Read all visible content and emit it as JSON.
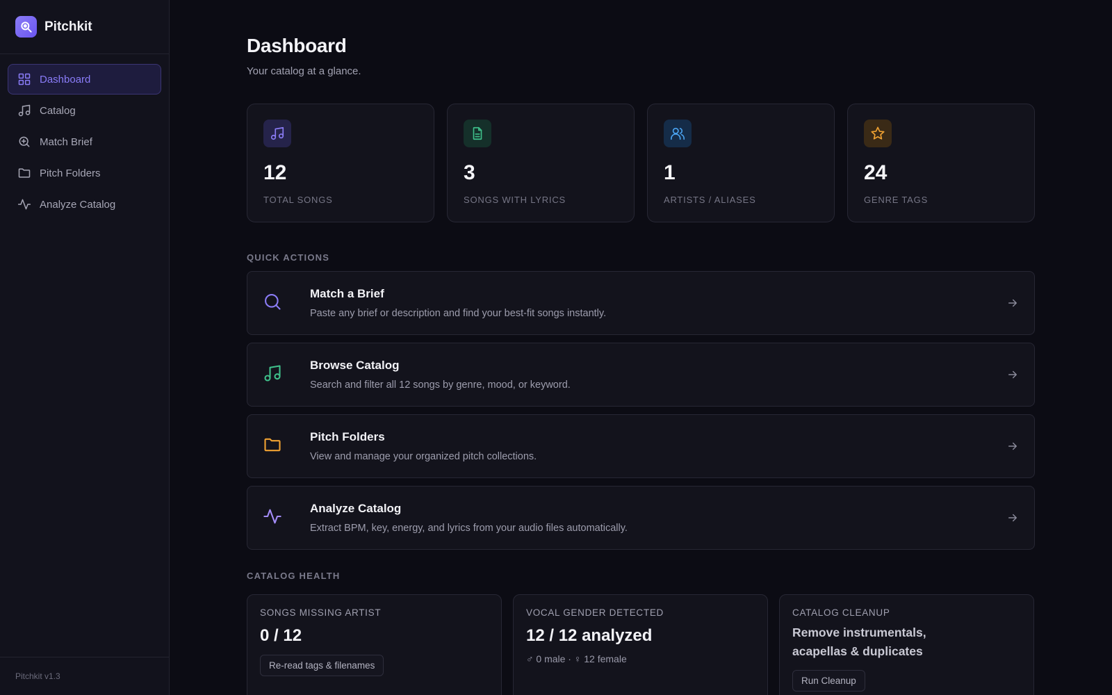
{
  "app": {
    "name": "Pitchkit",
    "version": "Pitchkit v1.3"
  },
  "sidebar": {
    "items": [
      {
        "label": "Dashboard",
        "icon": "grid-icon",
        "active": true
      },
      {
        "label": "Catalog",
        "icon": "music-note-icon"
      },
      {
        "label": "Match Brief",
        "icon": "search-plus-icon"
      },
      {
        "label": "Pitch Folders",
        "icon": "folder-icon"
      },
      {
        "label": "Analyze Catalog",
        "icon": "activity-icon"
      }
    ]
  },
  "page": {
    "title": "Dashboard",
    "subtitle": "Your catalog at a glance."
  },
  "stats": [
    {
      "value": "12",
      "label": "TOTAL SONGS",
      "icon": "music-note-icon",
      "color": "#8b7cf6"
    },
    {
      "value": "3",
      "label": "SONGS WITH LYRICS",
      "icon": "document-icon",
      "color": "#3fbf8a"
    },
    {
      "value": "1",
      "label": "ARTISTS / ALIASES",
      "icon": "users-icon",
      "color": "#4aa3f0"
    },
    {
      "value": "24",
      "label": "GENRE TAGS",
      "icon": "star-icon",
      "color": "#f0a232"
    }
  ],
  "quick_actions": {
    "title": "QUICK ACTIONS",
    "items": [
      {
        "title": "Match a Brief",
        "desc": "Paste any brief or description and find your best-fit songs instantly.",
        "icon": "search-icon"
      },
      {
        "title": "Browse Catalog",
        "desc": "Search and filter all 12 songs by genre, mood, or keyword.",
        "icon": "music-note-icon"
      },
      {
        "title": "Pitch Folders",
        "desc": "View and manage your organized pitch collections.",
        "icon": "folder-icon"
      },
      {
        "title": "Analyze Catalog",
        "desc": "Extract BPM, key, energy, and lyrics from your audio files automatically.",
        "icon": "activity-icon"
      }
    ]
  },
  "catalog_health": {
    "title": "CATALOG HEALTH",
    "missing_artist": {
      "label": "SONGS MISSING ARTIST",
      "value": "0 / 12",
      "button": "Re-read tags & filenames"
    },
    "vocal_gender": {
      "label": "VOCAL GENDER DETECTED",
      "value": "12 / 12 analyzed",
      "sub": "♂ 0 male · ♀ 12 female"
    },
    "cleanup": {
      "label": "CATALOG CLEANUP",
      "heading": "Remove instrumentals, acapellas & duplicates",
      "button": "Run Cleanup"
    }
  }
}
